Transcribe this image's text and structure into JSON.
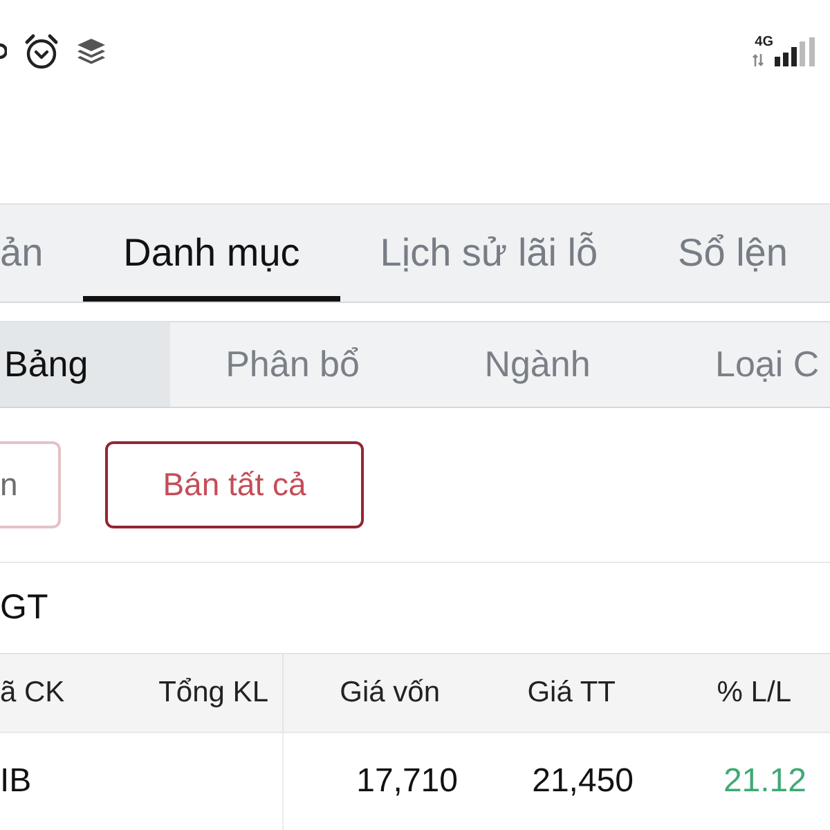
{
  "status_bar": {
    "network": "4G"
  },
  "tabs": [
    {
      "label": "ản",
      "selected": false
    },
    {
      "label": "Danh mục",
      "selected": true
    },
    {
      "label": "Lịch sử lãi lỗ",
      "selected": false
    },
    {
      "label": "Sổ lện",
      "selected": false
    }
  ],
  "view_tabs": [
    {
      "label": "Bảng",
      "selected": true
    },
    {
      "label": "Phân bổ",
      "selected": false
    },
    {
      "label": "Ngành",
      "selected": false
    },
    {
      "label": "Loại C",
      "selected": false
    }
  ],
  "actions": [
    {
      "label": "n",
      "kind": "secondary"
    },
    {
      "label": "Bán tất cả",
      "kind": "sell"
    }
  ],
  "summary": {
    "label": "GT"
  },
  "table": {
    "columns": [
      "ã CK",
      "Tổng KL",
      "Giá vốn",
      "Giá TT",
      "% L/L"
    ],
    "rows": [
      {
        "symbol": "IB",
        "cost_price": "17,710",
        "market_price": "21,450",
        "change_pct": "21.12",
        "color": "#3fa974"
      }
    ]
  }
}
